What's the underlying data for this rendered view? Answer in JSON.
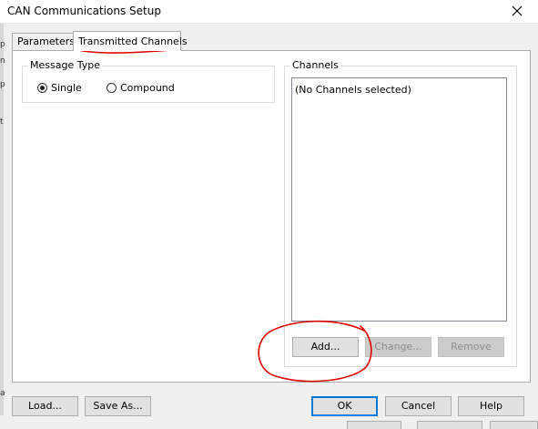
{
  "window": {
    "title": "CAN Communications Setup"
  },
  "tabs": [
    {
      "label": "Parameters",
      "active": false
    },
    {
      "label": "Transmitted Channels",
      "active": true
    }
  ],
  "message_type": {
    "legend": "Message Type",
    "options": [
      {
        "label": "Single",
        "selected": true
      },
      {
        "label": "Compound",
        "selected": false
      }
    ]
  },
  "channels": {
    "legend": "Channels",
    "empty_text": "(No Channels selected)",
    "add_label": "Add...",
    "change_label": "Change...",
    "remove_label": "Remove"
  },
  "footer": {
    "load_label": "Load...",
    "save_as_label": "Save As...",
    "ok_label": "OK",
    "cancel_label": "Cancel",
    "help_label": "Help"
  },
  "background_glyphs": [
    "p",
    "n",
    "p",
    "t",
    "a",
    "a"
  ],
  "colors": {
    "annotation": "#e00000",
    "default_button_border": "#0078d7"
  }
}
